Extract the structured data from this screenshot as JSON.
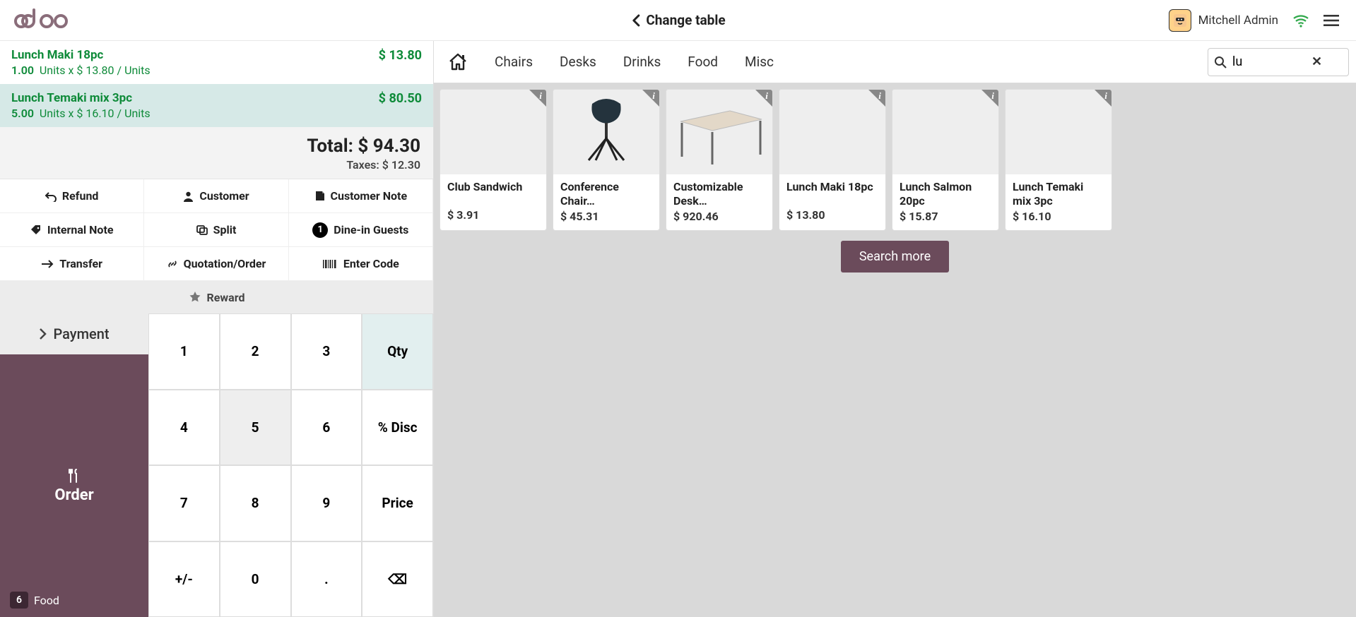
{
  "header": {
    "change_table": "Change table",
    "user": "Mitchell Admin"
  },
  "order": {
    "lines": [
      {
        "name": "Lunch Maki 18pc",
        "qty": "1.00",
        "unit_label": "Units x",
        "unit_price": "$ 13.80 / Units",
        "line_total": "$ 13.80",
        "selected": false
      },
      {
        "name": "Lunch Temaki mix 3pc",
        "qty": "5.00",
        "unit_label": "Units x",
        "unit_price": "$ 16.10 / Units",
        "line_total": "$ 80.50",
        "selected": true
      }
    ],
    "total_label": "Total:",
    "total_value": "$ 94.30",
    "taxes_label": "Taxes:",
    "taxes_value": "$ 12.30"
  },
  "actions": {
    "refund": "Refund",
    "customer": "Customer",
    "customer_note": "Customer Note",
    "internal_note": "Internal Note",
    "split": "Split",
    "dine_in_guests": "Dine-in Guests",
    "dine_in_count": "1",
    "transfer": "Transfer",
    "quotation": "Quotation/Order",
    "enter_code": "Enter Code",
    "reward": "Reward"
  },
  "bottom": {
    "payment": "Payment",
    "order": "Order",
    "floor_number": "6",
    "floor_label": "Food"
  },
  "numpad": {
    "k1": "1",
    "k2": "2",
    "k3": "3",
    "qty": "Qty",
    "k4": "4",
    "k5": "5",
    "k6": "6",
    "disc": "% Disc",
    "k7": "7",
    "k8": "8",
    "k9": "9",
    "price": "Price",
    "sign": "+/-",
    "k0": "0",
    "dot": ".",
    "back": "⌫"
  },
  "categories": [
    "Chairs",
    "Desks",
    "Drinks",
    "Food",
    "Misc"
  ],
  "search": {
    "value": "lu"
  },
  "products": [
    {
      "name": "Club Sandwich",
      "price": "$ 3.91",
      "imgclass": "img-sandwich"
    },
    {
      "name": "Conference Chair…",
      "price": "$ 45.31",
      "imgclass": "img-chair"
    },
    {
      "name": "Customizable Desk…",
      "price": "$ 920.46",
      "imgclass": "img-desk"
    },
    {
      "name": "Lunch Maki 18pc",
      "price": "$ 13.80",
      "imgclass": "img-maki"
    },
    {
      "name": "Lunch Salmon 20pc",
      "price": "$ 15.87",
      "imgclass": "img-salmon"
    },
    {
      "name": "Lunch Temaki mix 3pc",
      "price": "$ 16.10",
      "imgclass": "img-temaki"
    }
  ],
  "search_more": "Search more"
}
